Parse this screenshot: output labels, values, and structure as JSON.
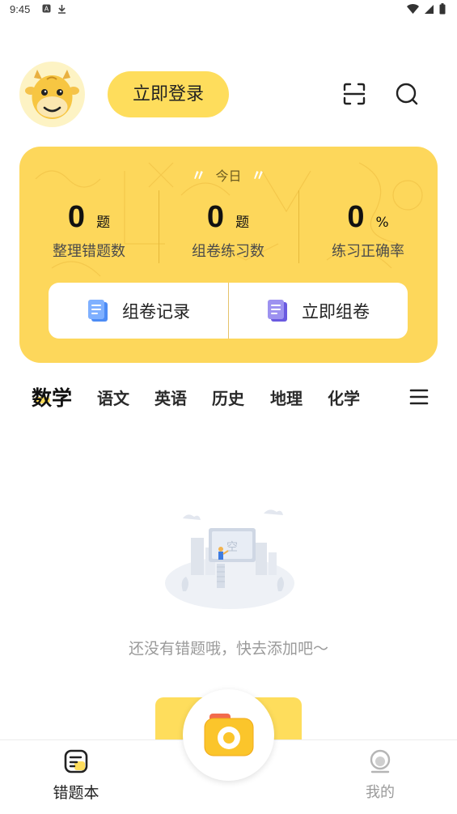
{
  "status_bar": {
    "time": "9:45",
    "left_icons": [
      "a-icon",
      "download-icon"
    ],
    "right_icons": [
      "wifi-icon",
      "signal-icon",
      "battery-icon"
    ]
  },
  "header": {
    "login_label": "立即登录",
    "icons": [
      "scan-icon",
      "search-icon"
    ]
  },
  "today_card": {
    "title": "今日",
    "stats": [
      {
        "value": "0",
        "unit": "题",
        "label": "整理错题数"
      },
      {
        "value": "0",
        "unit": "题",
        "label": "组卷练习数"
      },
      {
        "value": "0",
        "unit": "%",
        "label": "练习正确率"
      }
    ],
    "actions": [
      {
        "label": "组卷记录",
        "icon": "paper-record-icon"
      },
      {
        "label": "立即组卷",
        "icon": "compose-paper-icon"
      }
    ]
  },
  "subjects": {
    "active": "数学",
    "items": [
      "数学",
      "语文",
      "英语",
      "历史",
      "地理",
      "化学"
    ]
  },
  "empty_state": {
    "text": "还没有错题哦，快去添加吧～"
  },
  "bottom_nav": {
    "items": [
      {
        "label": "错题本",
        "icon": "wrongbook-icon",
        "active": true
      },
      {
        "label": "我的",
        "icon": "profile-icon",
        "active": false
      }
    ],
    "center_icon": "camera-icon"
  },
  "colors": {
    "accent": "#fedd5c",
    "card": "#fdd75b",
    "text_muted": "#9a9a9a"
  }
}
